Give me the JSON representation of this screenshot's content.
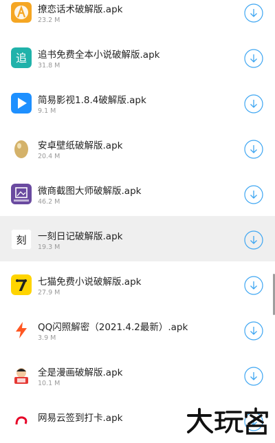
{
  "apps": [
    {
      "name": "撩恋话术破解版.apk",
      "size": "23.2 M",
      "icon": "liaolian-app-icon",
      "color": "#f5a623"
    },
    {
      "name": "追书免费全本小说破解版.apk",
      "size": "31.8 M",
      "icon": "zhuishu-app-icon",
      "color": "#20b2aa"
    },
    {
      "name": "简易影视1.8.4破解版.apk",
      "size": "9.1 M",
      "icon": "jianyi-video-app-icon",
      "color": "#1e90ff"
    },
    {
      "name": "安卓壁纸破解版.apk",
      "size": "20.4 M",
      "icon": "wallpaper-egg-app-icon",
      "color": "#d4b26a"
    },
    {
      "name": "微商截图大师破解版.apk",
      "size": "46.2 M",
      "icon": "screenshot-master-app-icon",
      "color": "#6a4aa0"
    },
    {
      "name": "一刻日记破解版.apk",
      "size": "19.3 M",
      "icon": "yike-diary-app-icon",
      "color": "#ffffff",
      "glyph": "刻"
    },
    {
      "name": "七猫免费小说破解版.apk",
      "size": "27.9 M",
      "icon": "qimao-app-icon",
      "color": "#ffd400",
      "glyph": "7"
    },
    {
      "name": "QQ闪照解密（2021.4.2最新）.apk",
      "size": "3.9 M",
      "icon": "flash-bolt-app-icon",
      "color": "#ff5722"
    },
    {
      "name": "全是漫画破解版.apk",
      "size": "10.1 M",
      "icon": "manhua-app-icon",
      "color": "#e53935"
    },
    {
      "name": "网易云签到打卡.apk",
      "size": "",
      "icon": "netease-app-icon",
      "color": "#e60026"
    }
  ],
  "highlight_index": 5,
  "accent": "#3ea6f2",
  "watermark": "大玩客"
}
